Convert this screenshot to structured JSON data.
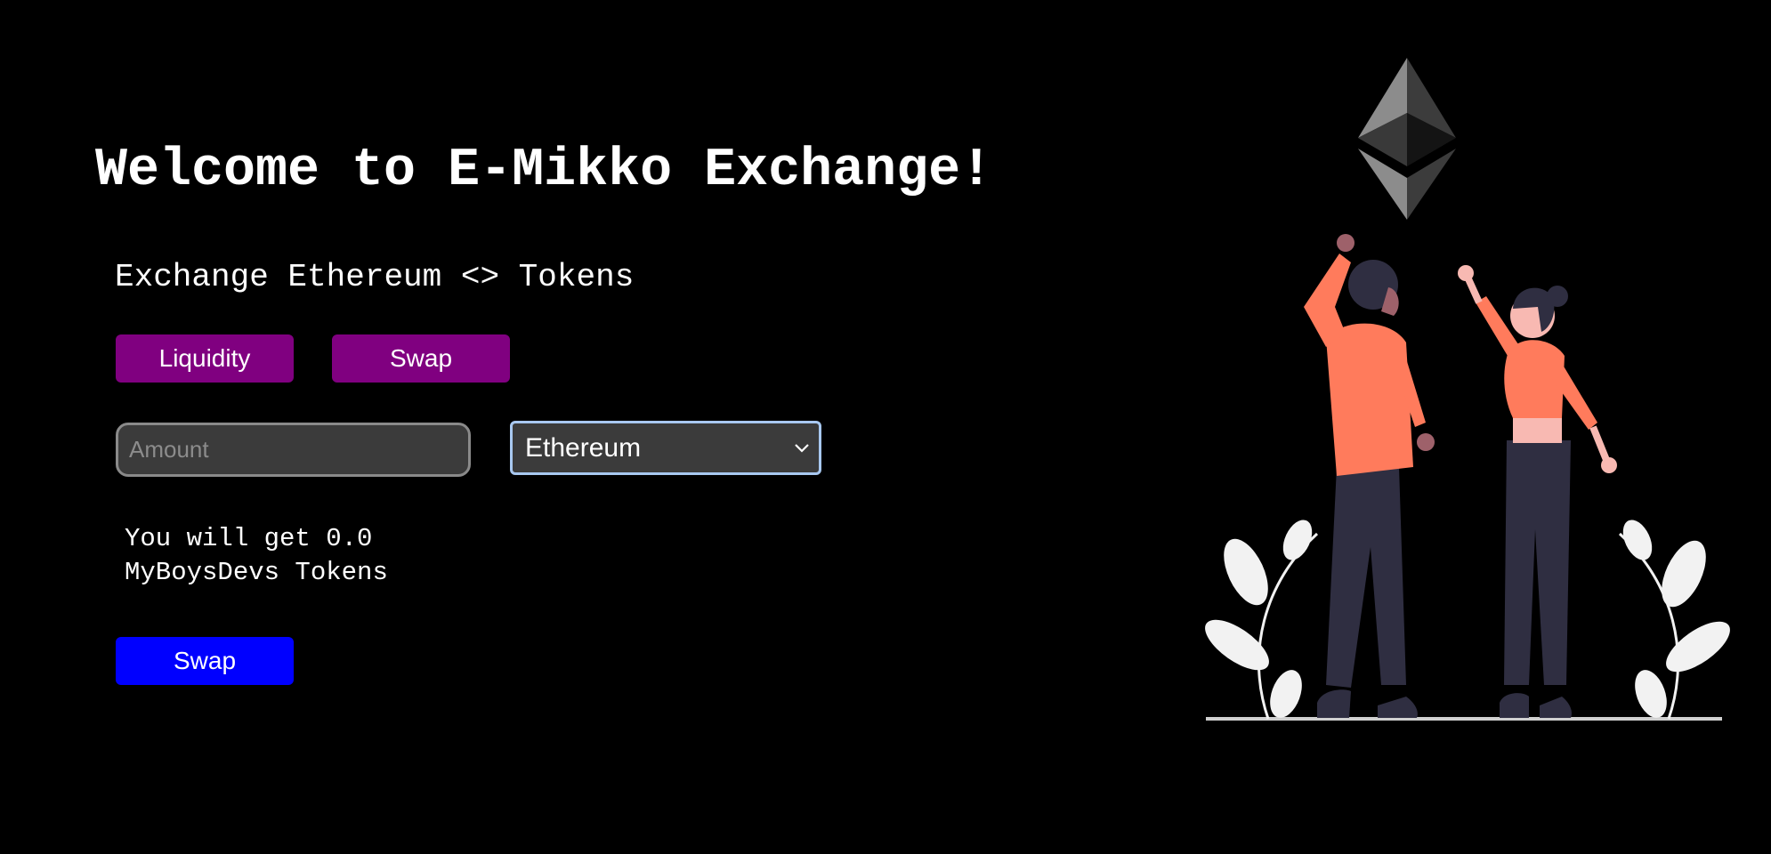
{
  "header": {
    "title": "Welcome to E-Mikko Exchange!",
    "subtitle": "Exchange Ethereum <> Tokens"
  },
  "tabs": {
    "liquidity_label": "Liquidity",
    "swap_label": "Swap"
  },
  "form": {
    "amount_placeholder": "Amount",
    "amount_value": "",
    "token_select": {
      "selected": "Ethereum",
      "options": [
        "Ethereum"
      ]
    },
    "result_text": "You will get 0.0 MyBoysDevs Tokens",
    "swap_button_label": "Swap"
  },
  "illustration": {
    "icon": "ethereum-logo-icon",
    "scene": "two-people-cheering-illustration"
  },
  "colors": {
    "background": "#000000",
    "tab_button": "#800080",
    "action_button": "#0000ff",
    "input_background": "#3b3b3b",
    "select_focus_border": "#a8c8f0",
    "shirt_accent": "#ff7b5c",
    "pants": "#2f2e41",
    "leaves": "#f2f2f2"
  }
}
